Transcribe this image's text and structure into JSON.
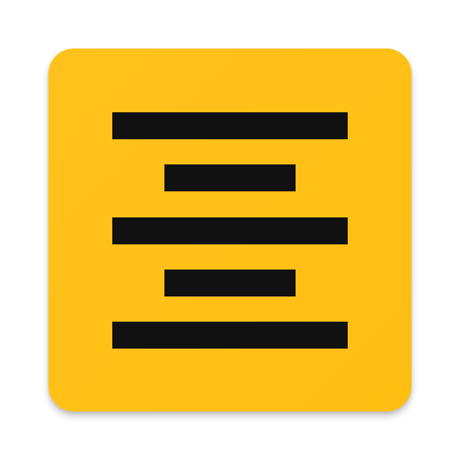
{
  "app_icon": {
    "icon": "align-center-icon",
    "colors": {
      "background": "#FFBE12",
      "background_highlight": "#FFC21C",
      "bars": "#111111"
    }
  }
}
